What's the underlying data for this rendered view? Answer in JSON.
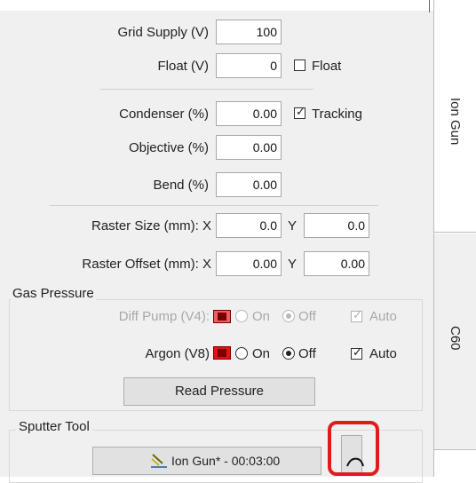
{
  "fields": {
    "grid_supply": {
      "label": "Grid Supply (V)",
      "value": "100"
    },
    "float_v": {
      "label": "Float (V)",
      "value": "0",
      "checkbox_label": "Float",
      "checked": false
    },
    "condenser": {
      "label": "Condenser (%)",
      "value": "0.00",
      "checkbox_label": "Tracking",
      "checked": true
    },
    "objective": {
      "label": "Objective (%)",
      "value": "0.00"
    },
    "bend": {
      "label": "Bend (%)",
      "value": "0.00"
    },
    "raster_size": {
      "label": "Raster Size (mm): X",
      "x": "0.0",
      "y_label": "Y",
      "y": "0.0"
    },
    "raster_offset": {
      "label": "Raster Offset (mm): X",
      "x": "0.00",
      "y_label": "Y",
      "y": "0.00"
    }
  },
  "gas_pressure": {
    "title": "Gas Pressure",
    "diff_pump": {
      "label": "Diff Pump (V4):",
      "on_label": "On",
      "off_label": "Off",
      "auto_label": "Auto",
      "selected": "Off",
      "auto": true,
      "enabled": false
    },
    "argon": {
      "label": "Argon (V8)",
      "on_label": "On",
      "off_label": "Off",
      "auto_label": "Auto",
      "selected": "Off",
      "auto": true,
      "enabled": true
    },
    "read_button": "Read Pressure"
  },
  "sputter_tool": {
    "title": "Sputter Tool",
    "button_label": "Ion Gun* - 00:03:00",
    "icon": "sputter-gun-icon",
    "side_button_icon": "arc-icon"
  },
  "tabs": [
    {
      "label": "Ion Gun"
    },
    {
      "label": "C60"
    }
  ],
  "colors": {
    "valve_red": "#e01515",
    "highlight_red": "#e01b1b"
  }
}
